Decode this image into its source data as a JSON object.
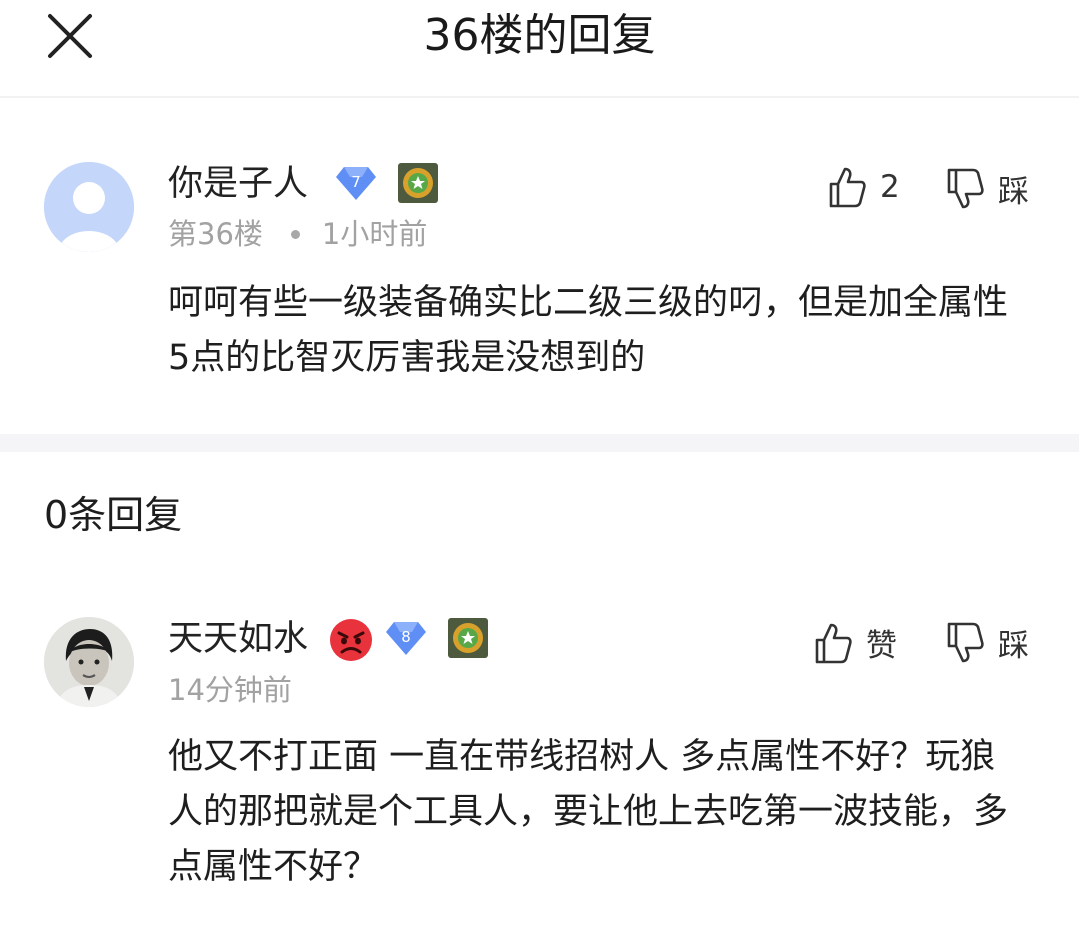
{
  "header": {
    "title": "36楼的回复",
    "close_icon": "close-icon"
  },
  "main_post": {
    "username": "你是子人",
    "level": "7",
    "floor": "第36楼",
    "time": "1小时前",
    "like_count": "2",
    "dislike_label": "踩",
    "content": "呵呵有些一级装备确实比二级三级的叼，但是加全属性5点的比智灭厉害我是没想到的"
  },
  "reply_section": {
    "count_label": "0条回复"
  },
  "reply": {
    "username": "天天如水",
    "emoji": "angry-face-icon",
    "level": "8",
    "time": "14分钟前",
    "like_label": "赞",
    "dislike_label": "踩",
    "content": "他又不打正面 一直在带线招树人 多点属性不好？玩狼人的那把就是个工具人，要让他上去吃第一波技能，多点属性不好？"
  },
  "colors": {
    "level_badge": "#5f8ff5",
    "meta_gray": "#a2a2a2",
    "band": "#f5f5f7"
  }
}
